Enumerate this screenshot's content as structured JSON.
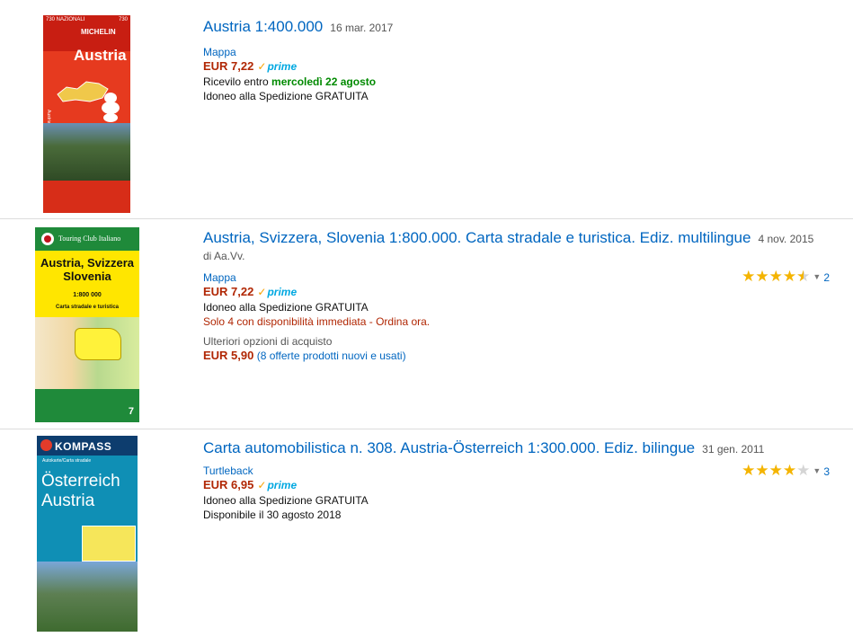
{
  "results": [
    {
      "cover": {
        "num_left": "730 NAZIONALI",
        "num_right": "730",
        "brand": "MICHELIN",
        "title": "Austria",
        "side": "Austria"
      },
      "title": "Austria 1:400.000",
      "date": "16 mar. 2017",
      "format": "Mappa",
      "price": "EUR 7,22",
      "prime_check": "✓",
      "prime": "prime",
      "delivery_prefix": "Ricevilo entro ",
      "delivery_date": "mercoledì 22 agosto",
      "shipping": "Idoneo alla Spedizione GRATUITA"
    },
    {
      "cover": {
        "brand": "Touring Club Italiano",
        "title_line1": "Austria, Svizzera",
        "title_line2": "Slovenia",
        "scale": "1:800 000",
        "subtitle": "Carta stradale e turistica",
        "number": "7"
      },
      "title": "Austria, Svizzera, Slovenia 1:800.000. Carta stradale e turistica. Ediz. multilingue",
      "date": "4 nov. 2015",
      "author": "di Aa.Vv.",
      "format": "Mappa",
      "price": "EUR 7,22",
      "prime_check": "✓",
      "prime": "prime",
      "shipping": "Idoneo alla Spedizione GRATUITA",
      "stock": "Solo 4 con disponibilità immediata - Ordina ora.",
      "more_options": "Ulteriori opzioni di acquisto",
      "used_price": "EUR 5,90",
      "offers": "(8 offerte prodotti nuovi e usati)",
      "rating": 4.5,
      "rating_count": "2"
    },
    {
      "cover": {
        "brand": "KOMPASS",
        "small": "Autokarte/Carta stradale",
        "title_line1": "Österreich",
        "title_line2": "Austria"
      },
      "title": "Carta automobilistica n. 308. Austria-Österreich 1:300.000. Ediz. bilingue",
      "date": "31 gen. 2011",
      "format": "Turtleback",
      "price": "EUR 6,95",
      "prime_check": "✓",
      "prime": "prime",
      "shipping": "Idoneo alla Spedizione GRATUITA",
      "availability": "Disponibile il 30 agosto 2018",
      "rating": 4,
      "rating_count": "3"
    }
  ],
  "icons": {
    "star_full": "★",
    "star_empty": "☆",
    "caret": "▼"
  },
  "colors": {
    "link": "#0066c0",
    "price": "#b12704",
    "prime": "#00a8e1",
    "delivery": "#008a00",
    "star": "#f4b400"
  }
}
